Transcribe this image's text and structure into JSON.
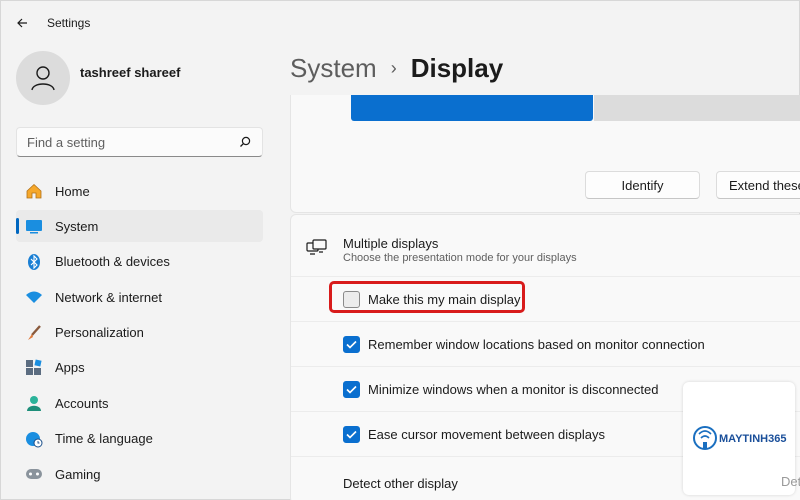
{
  "app": {
    "title": "Settings"
  },
  "user": {
    "name": "tashreef shareef"
  },
  "search": {
    "placeholder": "Find a setting"
  },
  "sidebar": {
    "items": [
      {
        "label": "Home",
        "icon": "home-icon",
        "active": false
      },
      {
        "label": "System",
        "icon": "system-icon",
        "active": true
      },
      {
        "label": "Bluetooth & devices",
        "icon": "bluetooth-icon",
        "active": false
      },
      {
        "label": "Network & internet",
        "icon": "wifi-icon",
        "active": false
      },
      {
        "label": "Personalization",
        "icon": "brush-icon",
        "active": false
      },
      {
        "label": "Apps",
        "icon": "apps-icon",
        "active": false
      },
      {
        "label": "Accounts",
        "icon": "accounts-icon",
        "active": false
      },
      {
        "label": "Time & language",
        "icon": "globe-clock-icon",
        "active": false
      },
      {
        "label": "Gaming",
        "icon": "gamepad-icon",
        "active": false
      }
    ]
  },
  "header": {
    "parent": "System",
    "separator": "›",
    "current": "Display"
  },
  "arrangement": {
    "identify_label": "Identify",
    "extend_label": "Extend these"
  },
  "multiple_displays": {
    "title": "Multiple displays",
    "description": "Choose the presentation mode for your displays",
    "options": [
      {
        "label": "Make this my main display",
        "checked": false
      },
      {
        "label": "Remember window locations based on monitor connection",
        "checked": true
      },
      {
        "label": "Minimize windows when a monitor is disconnected",
        "checked": true
      },
      {
        "label": "Ease cursor movement between displays",
        "checked": true
      }
    ],
    "detect_label": "Detect other display"
  },
  "watermark": {
    "text": "MAYTINH365"
  },
  "clipped_text": "Det",
  "colors": {
    "accent": "#0067c0",
    "checkbox_blue": "#0a6fcf",
    "highlight_red": "#d81b1b"
  }
}
